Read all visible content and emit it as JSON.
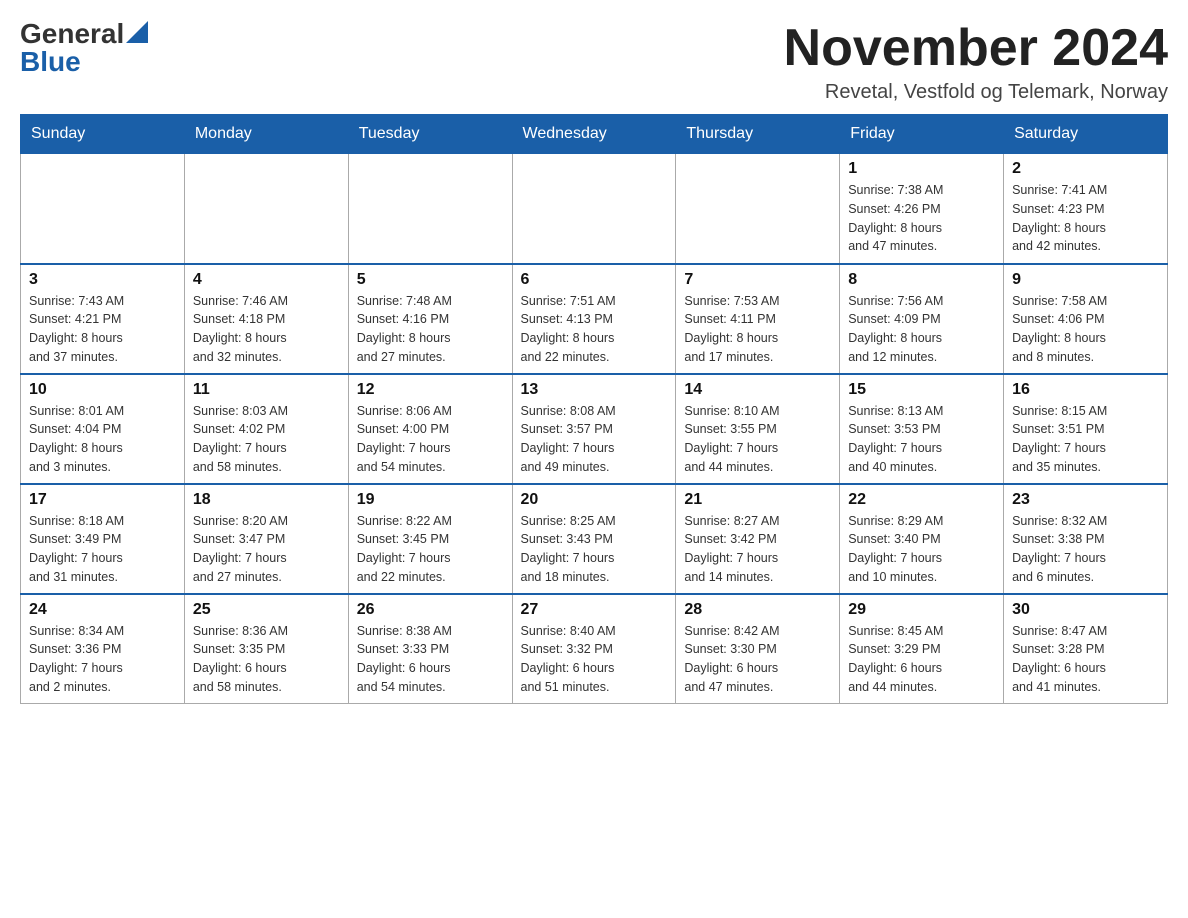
{
  "header": {
    "logo_general": "General",
    "logo_blue": "Blue",
    "month_title": "November 2024",
    "location": "Revetal, Vestfold og Telemark, Norway"
  },
  "weekdays": [
    "Sunday",
    "Monday",
    "Tuesday",
    "Wednesday",
    "Thursday",
    "Friday",
    "Saturday"
  ],
  "weeks": [
    [
      {
        "day": "",
        "info": ""
      },
      {
        "day": "",
        "info": ""
      },
      {
        "day": "",
        "info": ""
      },
      {
        "day": "",
        "info": ""
      },
      {
        "day": "",
        "info": ""
      },
      {
        "day": "1",
        "info": "Sunrise: 7:38 AM\nSunset: 4:26 PM\nDaylight: 8 hours\nand 47 minutes."
      },
      {
        "day": "2",
        "info": "Sunrise: 7:41 AM\nSunset: 4:23 PM\nDaylight: 8 hours\nand 42 minutes."
      }
    ],
    [
      {
        "day": "3",
        "info": "Sunrise: 7:43 AM\nSunset: 4:21 PM\nDaylight: 8 hours\nand 37 minutes."
      },
      {
        "day": "4",
        "info": "Sunrise: 7:46 AM\nSunset: 4:18 PM\nDaylight: 8 hours\nand 32 minutes."
      },
      {
        "day": "5",
        "info": "Sunrise: 7:48 AM\nSunset: 4:16 PM\nDaylight: 8 hours\nand 27 minutes."
      },
      {
        "day": "6",
        "info": "Sunrise: 7:51 AM\nSunset: 4:13 PM\nDaylight: 8 hours\nand 22 minutes."
      },
      {
        "day": "7",
        "info": "Sunrise: 7:53 AM\nSunset: 4:11 PM\nDaylight: 8 hours\nand 17 minutes."
      },
      {
        "day": "8",
        "info": "Sunrise: 7:56 AM\nSunset: 4:09 PM\nDaylight: 8 hours\nand 12 minutes."
      },
      {
        "day": "9",
        "info": "Sunrise: 7:58 AM\nSunset: 4:06 PM\nDaylight: 8 hours\nand 8 minutes."
      }
    ],
    [
      {
        "day": "10",
        "info": "Sunrise: 8:01 AM\nSunset: 4:04 PM\nDaylight: 8 hours\nand 3 minutes."
      },
      {
        "day": "11",
        "info": "Sunrise: 8:03 AM\nSunset: 4:02 PM\nDaylight: 7 hours\nand 58 minutes."
      },
      {
        "day": "12",
        "info": "Sunrise: 8:06 AM\nSunset: 4:00 PM\nDaylight: 7 hours\nand 54 minutes."
      },
      {
        "day": "13",
        "info": "Sunrise: 8:08 AM\nSunset: 3:57 PM\nDaylight: 7 hours\nand 49 minutes."
      },
      {
        "day": "14",
        "info": "Sunrise: 8:10 AM\nSunset: 3:55 PM\nDaylight: 7 hours\nand 44 minutes."
      },
      {
        "day": "15",
        "info": "Sunrise: 8:13 AM\nSunset: 3:53 PM\nDaylight: 7 hours\nand 40 minutes."
      },
      {
        "day": "16",
        "info": "Sunrise: 8:15 AM\nSunset: 3:51 PM\nDaylight: 7 hours\nand 35 minutes."
      }
    ],
    [
      {
        "day": "17",
        "info": "Sunrise: 8:18 AM\nSunset: 3:49 PM\nDaylight: 7 hours\nand 31 minutes."
      },
      {
        "day": "18",
        "info": "Sunrise: 8:20 AM\nSunset: 3:47 PM\nDaylight: 7 hours\nand 27 minutes."
      },
      {
        "day": "19",
        "info": "Sunrise: 8:22 AM\nSunset: 3:45 PM\nDaylight: 7 hours\nand 22 minutes."
      },
      {
        "day": "20",
        "info": "Sunrise: 8:25 AM\nSunset: 3:43 PM\nDaylight: 7 hours\nand 18 minutes."
      },
      {
        "day": "21",
        "info": "Sunrise: 8:27 AM\nSunset: 3:42 PM\nDaylight: 7 hours\nand 14 minutes."
      },
      {
        "day": "22",
        "info": "Sunrise: 8:29 AM\nSunset: 3:40 PM\nDaylight: 7 hours\nand 10 minutes."
      },
      {
        "day": "23",
        "info": "Sunrise: 8:32 AM\nSunset: 3:38 PM\nDaylight: 7 hours\nand 6 minutes."
      }
    ],
    [
      {
        "day": "24",
        "info": "Sunrise: 8:34 AM\nSunset: 3:36 PM\nDaylight: 7 hours\nand 2 minutes."
      },
      {
        "day": "25",
        "info": "Sunrise: 8:36 AM\nSunset: 3:35 PM\nDaylight: 6 hours\nand 58 minutes."
      },
      {
        "day": "26",
        "info": "Sunrise: 8:38 AM\nSunset: 3:33 PM\nDaylight: 6 hours\nand 54 minutes."
      },
      {
        "day": "27",
        "info": "Sunrise: 8:40 AM\nSunset: 3:32 PM\nDaylight: 6 hours\nand 51 minutes."
      },
      {
        "day": "28",
        "info": "Sunrise: 8:42 AM\nSunset: 3:30 PM\nDaylight: 6 hours\nand 47 minutes."
      },
      {
        "day": "29",
        "info": "Sunrise: 8:45 AM\nSunset: 3:29 PM\nDaylight: 6 hours\nand 44 minutes."
      },
      {
        "day": "30",
        "info": "Sunrise: 8:47 AM\nSunset: 3:28 PM\nDaylight: 6 hours\nand 41 minutes."
      }
    ]
  ]
}
